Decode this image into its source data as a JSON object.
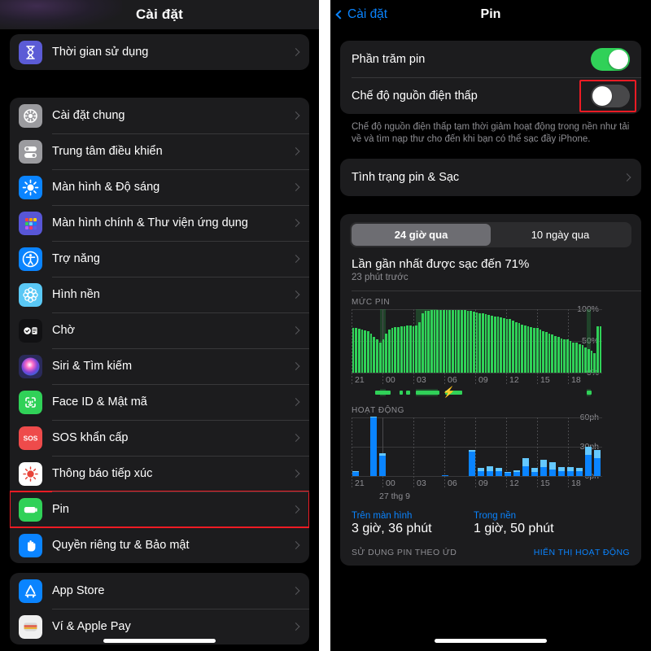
{
  "left_panel": {
    "nav_title": "Cài đặt",
    "groups": [
      {
        "items": [
          {
            "label": "Thời gian sử dụng",
            "icon": "hourglass-icon",
            "highlighted": false
          }
        ]
      },
      {
        "items": [
          {
            "label": "Cài đặt chung",
            "icon": "gear-icon",
            "highlighted": false
          },
          {
            "label": "Trung tâm điều khiển",
            "icon": "control-center-icon",
            "highlighted": false
          },
          {
            "label": "Màn hình & Độ sáng",
            "icon": "brightness-icon",
            "highlighted": false
          },
          {
            "label": "Màn hình chính & Thư viện ứng dụng",
            "icon": "home-screen-icon",
            "highlighted": false
          },
          {
            "label": "Trợ năng",
            "icon": "accessibility-icon",
            "highlighted": false
          },
          {
            "label": "Hình nền",
            "icon": "wallpaper-icon",
            "highlighted": false
          },
          {
            "label": "Chờ",
            "icon": "standby-icon",
            "highlighted": false
          },
          {
            "label": "Siri & Tìm kiếm",
            "icon": "siri-icon",
            "highlighted": false
          },
          {
            "label": "Face ID & Mật mã",
            "icon": "face-id-icon",
            "highlighted": false
          },
          {
            "label": "SOS khẩn cấp",
            "icon": "sos-icon",
            "highlighted": false
          },
          {
            "label": "Thông báo tiếp xúc",
            "icon": "exposure-notification-icon",
            "highlighted": false
          },
          {
            "label": "Pin",
            "icon": "battery-icon",
            "highlighted": true
          },
          {
            "label": "Quyền riêng tư & Bảo mật",
            "icon": "privacy-hand-icon",
            "highlighted": false
          }
        ]
      },
      {
        "items": [
          {
            "label": "App Store",
            "icon": "app-store-icon",
            "highlighted": false
          },
          {
            "label": "Ví & Apple Pay",
            "icon": "wallet-icon",
            "highlighted": false
          }
        ]
      }
    ]
  },
  "right_panel": {
    "back_label": "Cài đặt",
    "nav_title": "Pin",
    "toggles": [
      {
        "label": "Phần trăm pin",
        "state": "on",
        "highlighted": false
      },
      {
        "label": "Chế độ nguồn điện thấp",
        "state": "off",
        "highlighted": true
      }
    ],
    "footnote": "Chế độ nguồn điện thấp tạm thời giảm hoạt động trong nền như tải về và tìm nạp thư cho đến khi bạn có thể sạc đầy iPhone.",
    "health_link": "Tình trạng pin & Sạc",
    "segments": [
      {
        "label": "24 giờ qua",
        "active": true
      },
      {
        "label": "10 ngày qua",
        "active": false
      }
    ],
    "last_charge_title": "Lần gần nhất được sạc đến 71%",
    "last_charge_sub": "23 phút trước",
    "usage": [
      {
        "caption": "Trên màn hình",
        "value": "3 giờ, 36 phút"
      },
      {
        "caption": "Trong nền",
        "value": "1 giờ, 50 phút"
      }
    ],
    "bottom_bar": {
      "left": "SỬ DỤNG PIN THEO ỨD",
      "right": "HIỂN THỊ HOẠT ĐỘNG"
    },
    "date_label": "27 thg 9",
    "colors": {
      "battery_green": "#30d158",
      "activity_blue": "#0a84ff",
      "activity_blue_light": "#64c8ff",
      "accent_blue": "#0a84ff",
      "highlight_red": "#ee1b24"
    }
  },
  "chart_data": [
    {
      "type": "bar",
      "title": "MỨC PIN",
      "xlabel": "",
      "ylabel": "",
      "ylim": [
        0,
        100
      ],
      "ytick_labels": [
        "0%",
        "50%",
        "100%"
      ],
      "yticks": [
        0,
        50,
        100
      ],
      "xtick_labels": [
        "21",
        "00",
        "03",
        "06",
        "09",
        "12",
        "15",
        "18"
      ],
      "xticks": [
        21,
        0,
        3,
        6,
        9,
        12,
        15,
        18
      ],
      "grid": true,
      "legend": "none",
      "series_color": "#30d158",
      "values": [
        70,
        70,
        69,
        68,
        67,
        65,
        62,
        57,
        52,
        48,
        53,
        62,
        68,
        71,
        72,
        72,
        73,
        73,
        74,
        74,
        73,
        74,
        80,
        93,
        97,
        98,
        99,
        99,
        99,
        99,
        99,
        99,
        99,
        99,
        99,
        99,
        99,
        99,
        98,
        97,
        96,
        95,
        94,
        93,
        92,
        91,
        90,
        89,
        88,
        87,
        86,
        85,
        84,
        82,
        80,
        78,
        76,
        74,
        73,
        72,
        71,
        70,
        68,
        66,
        64,
        62,
        60,
        58,
        56,
        54,
        53,
        52,
        50,
        48,
        47,
        45,
        43,
        40,
        37,
        34,
        31,
        73,
        73
      ],
      "charge_bands": [
        [
          9.5,
          11.5
        ],
        [
          21.5,
          29.0
        ],
        [
          79.0,
          80.2
        ]
      ],
      "charge_strip_segments": [
        [
          8.0,
          13.0
        ],
        [
          16.0,
          17.2
        ],
        [
          18.4,
          19.6
        ],
        [
          21.5,
          29.5
        ],
        [
          31.5,
          37.0
        ],
        [
          79.0,
          80.5
        ]
      ],
      "annotations": [
        {
          "symbol": "bolt",
          "position": 30.5
        }
      ]
    },
    {
      "type": "bar",
      "title": "HOẠT ĐỘNG",
      "xlabel": "",
      "ylabel": "",
      "ylim": [
        0,
        60
      ],
      "ytick_labels": [
        "0ph",
        "30ph",
        "60ph"
      ],
      "yticks": [
        0,
        30,
        60
      ],
      "xtick_labels": [
        "21",
        "00",
        "03",
        "06",
        "09",
        "12",
        "15",
        "18"
      ],
      "xticks": [
        21,
        0,
        3,
        6,
        9,
        12,
        15,
        18
      ],
      "grid": true,
      "legend": "none",
      "series": [
        {
          "name": "Trên màn hình",
          "color": "#0a84ff",
          "values": [
            4,
            0,
            60,
            21,
            0,
            0,
            0,
            0,
            0,
            0,
            1,
            0,
            0,
            25,
            5,
            5,
            5,
            3,
            4,
            10,
            4,
            9,
            7,
            5,
            5,
            5,
            22,
            18
          ]
        },
        {
          "name": "Trong nền",
          "color": "#64c8ff",
          "values": [
            1,
            0,
            1,
            2,
            0,
            0,
            0,
            0,
            0,
            0,
            0,
            0,
            0,
            2,
            3,
            5,
            3,
            1,
            2,
            8,
            4,
            8,
            7,
            4,
            4,
            3,
            8,
            9
          ]
        }
      ],
      "hours": [
        21,
        22,
        23,
        0,
        1,
        2,
        3,
        4,
        5,
        6,
        7,
        8,
        9,
        10,
        11,
        12,
        13,
        14,
        15,
        16,
        17,
        18,
        19,
        20,
        21,
        22,
        23,
        24
      ]
    }
  ]
}
